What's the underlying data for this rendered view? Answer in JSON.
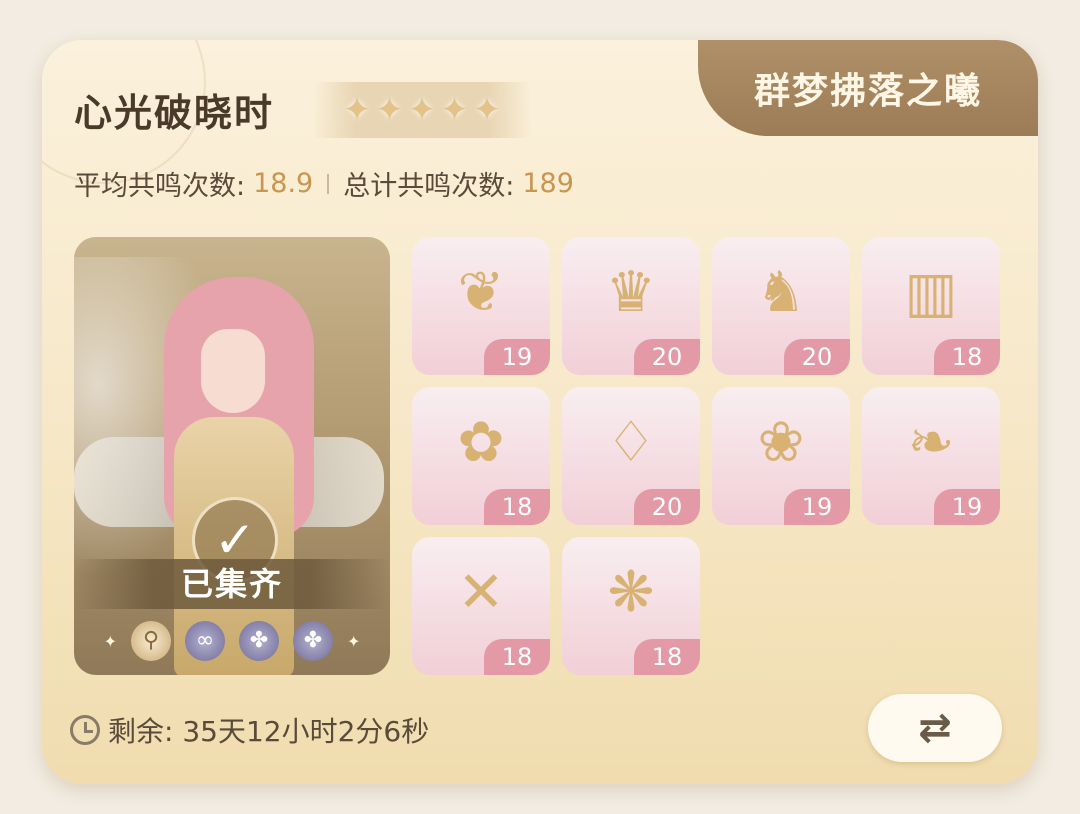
{
  "card": {
    "title": "心光破晓时",
    "tab_label": "群梦拂落之曦",
    "star_count": 5,
    "stats": {
      "avg_label": "平均共鸣次数:",
      "avg_value": "18.9",
      "total_label": "总计共鸣次数:",
      "total_value": "189"
    },
    "portrait": {
      "status": "已集齐",
      "check_glyph": "✓",
      "gems": [
        "key-gem",
        "infinity-gem",
        "clover-gem",
        "clover-gem"
      ]
    },
    "items": [
      {
        "icon": "feather-hair-accessory-icon",
        "glyph": "❦",
        "count": "19"
      },
      {
        "icon": "gown-icon",
        "glyph": "♛",
        "count": "20"
      },
      {
        "icon": "heeled-shoes-icon",
        "glyph": "♞",
        "count": "20"
      },
      {
        "icon": "arm-wraps-icon",
        "glyph": "▥",
        "count": "18"
      },
      {
        "icon": "floral-chain-icon",
        "glyph": "✿",
        "count": "18"
      },
      {
        "icon": "earrings-icon",
        "glyph": "♢",
        "count": "20"
      },
      {
        "icon": "pink-hairstyle-icon",
        "glyph": "❀",
        "count": "19"
      },
      {
        "icon": "pearl-collar-icon",
        "glyph": "❧",
        "count": "19"
      },
      {
        "icon": "scepter-icon",
        "glyph": "✕",
        "count": "18"
      },
      {
        "icon": "wing-ornament-icon",
        "glyph": "❋",
        "count": "18"
      }
    ],
    "remaining": {
      "label": "剩余: 35天12小时2分6秒"
    },
    "swap_glyph": "⇄"
  }
}
